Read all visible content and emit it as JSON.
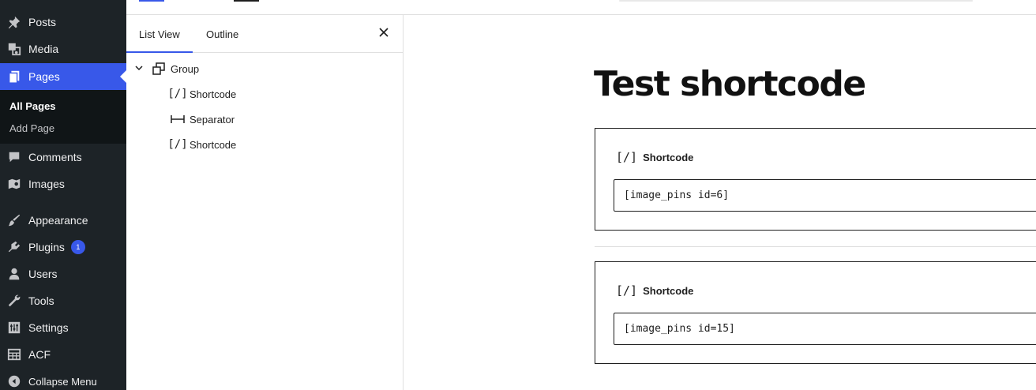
{
  "admin_menu": {
    "items": [
      {
        "label": "Posts",
        "icon": "pin-icon"
      },
      {
        "label": "Media",
        "icon": "media-icon"
      },
      {
        "label": "Pages",
        "icon": "pages-icon"
      },
      {
        "label": "Comments",
        "icon": "comment-icon"
      },
      {
        "label": "Images",
        "icon": "images-icon"
      },
      {
        "label": "Appearance",
        "icon": "brush-icon"
      },
      {
        "label": "Plugins",
        "icon": "plugin-icon",
        "badge": "1"
      },
      {
        "label": "Users",
        "icon": "user-icon"
      },
      {
        "label": "Tools",
        "icon": "wrench-icon"
      },
      {
        "label": "Settings",
        "icon": "settings-icon"
      },
      {
        "label": "ACF",
        "icon": "acf-icon"
      },
      {
        "label": "Collapse Menu",
        "icon": "collapse-icon"
      }
    ],
    "submenu": [
      {
        "label": "All Pages"
      },
      {
        "label": "Add Page"
      }
    ]
  },
  "list_view": {
    "tabs": [
      {
        "label": "List View"
      },
      {
        "label": "Outline"
      }
    ],
    "tree": [
      {
        "label": "Group",
        "icon": "group-icon"
      },
      {
        "label": "Shortcode",
        "icon": "shortcode-icon"
      },
      {
        "label": "Separator",
        "icon": "separator-icon"
      },
      {
        "label": "Shortcode",
        "icon": "shortcode-icon"
      }
    ]
  },
  "canvas": {
    "title": "Test shortcode",
    "blocks": [
      {
        "label": "Shortcode",
        "icon_text": "[/]",
        "value": "[image_pins id=6]"
      },
      {
        "label": "Shortcode",
        "icon_text": "[/]",
        "value": "[image_pins id=15]"
      }
    ]
  },
  "colors": {
    "admin_bg": "#1d2327",
    "accent": "#3858e9",
    "submenu_bg": "#101517"
  }
}
